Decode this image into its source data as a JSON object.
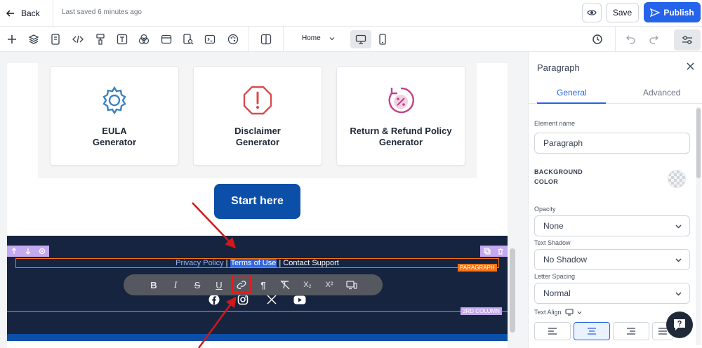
{
  "topbar": {
    "back_label": "Back",
    "saved_status": "Last saved 6 minutes ago",
    "save_label": "Save",
    "publish_label": "Publish"
  },
  "toolbar": {
    "page_select": "Home"
  },
  "canvas": {
    "cards": [
      {
        "title": "EULA\nGenerator",
        "icon": "gear-icon",
        "color": "#3b82c4"
      },
      {
        "title": "Disclaimer\nGenerator",
        "icon": "alert-octagon-icon",
        "color": "#dc4a4a"
      },
      {
        "title": "Return & Refund Policy\nGenerator",
        "icon": "percent-refund-icon",
        "color": "#c2418b"
      }
    ],
    "start_button": "Start here",
    "footer": {
      "link_privacy": "Privacy Policy",
      "sep1": " | ",
      "link_terms": "Terms of Use",
      "sep2": " | ",
      "link_support": "Contact Support",
      "paragraph_label": "PARAGRAPH",
      "column_label": "3RD COLUMN"
    },
    "format_toolbar": {
      "bold": "B",
      "italic": "I",
      "strike": "S",
      "underline": "U",
      "pilcrow": "¶",
      "subscript": "X₂",
      "superscript": "X²"
    }
  },
  "panel": {
    "title": "Paragraph",
    "tabs": [
      "General",
      "Advanced"
    ],
    "element_name_label": "Element name",
    "element_name_value": "Paragraph",
    "background_color_label_1": "BACKGROUND",
    "background_color_label_2": "COLOR",
    "opacity_label": "Opacity",
    "opacity_value": "None",
    "text_shadow_label": "Text Shadow",
    "text_shadow_value": "No Shadow",
    "letter_spacing_label": "Letter Spacing",
    "letter_spacing_value": "Normal",
    "text_align_label": "Text Align"
  },
  "colors": {
    "accent": "#2563eb",
    "footer_bg": "#16243f",
    "start_btn": "#0b4fa8",
    "annotation_arrow": "#d01818"
  }
}
